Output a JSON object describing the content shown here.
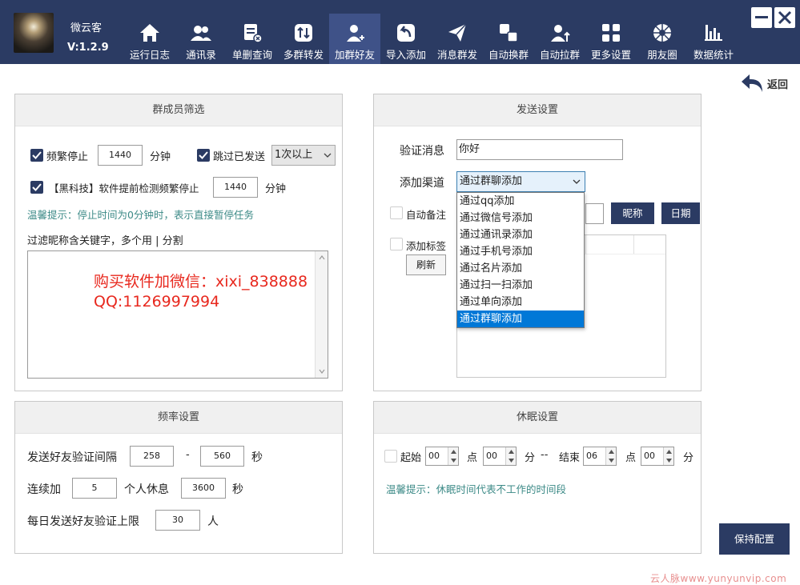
{
  "app": {
    "name": "微云客",
    "version": "V:1.2.9"
  },
  "nav": {
    "items": [
      {
        "label": "运行日志",
        "icon": "home-icon"
      },
      {
        "label": "通讯录",
        "icon": "contacts-icon"
      },
      {
        "label": "单删查询",
        "icon": "delete-check-icon"
      },
      {
        "label": "多群转发",
        "icon": "transfer-icon"
      },
      {
        "label": "加群好友",
        "icon": "add-friend-icon",
        "active": true
      },
      {
        "label": "导入添加",
        "icon": "import-icon"
      },
      {
        "label": "消息群发",
        "icon": "send-icon"
      },
      {
        "label": "自动换群",
        "icon": "switch-group-icon"
      },
      {
        "label": "自动拉群",
        "icon": "pull-group-icon"
      },
      {
        "label": "更多设置",
        "icon": "grid-settings-icon"
      },
      {
        "label": "朋友圈",
        "icon": "moments-icon"
      },
      {
        "label": "数据统计",
        "icon": "bar-chart-icon"
      }
    ]
  },
  "back": {
    "label": "返回"
  },
  "member_filter": {
    "title": "群成员筛选",
    "freq_stop_label": "频繁停止",
    "freq_stop_value": "1440",
    "minutes_unit": "分钟",
    "skip_sent_label": "跳过已发送",
    "skip_sent_select": "1次以上",
    "black_tech_label": "【黑科技】软件提前检测频繁停止",
    "black_tech_value": "1440",
    "black_tech_unit": "分钟",
    "tip": "温馨提示：停止时间为0分钟时，表示直接暂停任务",
    "filter_label": "过滤昵称含关键字，多个用 | 分割",
    "filter_text_line1": "购买软件加微信：xixi_838888",
    "filter_text_line2": "QQ:1126997994"
  },
  "send_settings": {
    "title": "发送设置",
    "verify_label": "验证消息",
    "verify_value": "你好",
    "channel_label": "添加渠道",
    "channel_selected": "通过群聊添加",
    "channel_options": [
      "通过qq添加",
      "通过微信号添加",
      "通过通讯录添加",
      "通过手机号添加",
      "通过名片添加",
      "通过扫一扫添加",
      "通过单向添加",
      "通过群聊添加"
    ],
    "auto_remark_label": "自动备注",
    "nickname_btn": "昵称",
    "date_btn": "日期",
    "add_tag_label": "添加标签",
    "refresh_btn": "刷新"
  },
  "rate_settings": {
    "title": "频率设置",
    "interval_label": "发送好友验证间隔",
    "interval_min": "258",
    "interval_dash": "-",
    "interval_max": "560",
    "sec_unit": "秒",
    "consecutive_label": "连续加",
    "consecutive_value": "5",
    "rest_label": "个人休息",
    "rest_value": "3600",
    "rest_unit": "秒",
    "daily_label": "每日发送好友验证上限",
    "daily_value": "30",
    "daily_unit": "人"
  },
  "sleep_settings": {
    "title": "休眠设置",
    "start_label": "起始",
    "start_hour": "00",
    "hour_unit": "点",
    "start_min": "00",
    "min_unit": "分",
    "separator": "--",
    "end_label": "结束",
    "end_hour": "06",
    "end_min": "00",
    "tip": "温馨提示：休眠时间代表不工作的时间段"
  },
  "save_btn": "保持配置",
  "watermark": "云人脉www.yunyunvip.com",
  "colors": {
    "topbar": "#2b3b63",
    "active_tab": "#3f5288",
    "accent": "#2b3b63",
    "tip": "#3c8a87",
    "red_text": "#e8281e",
    "selection": "#0078d7"
  }
}
